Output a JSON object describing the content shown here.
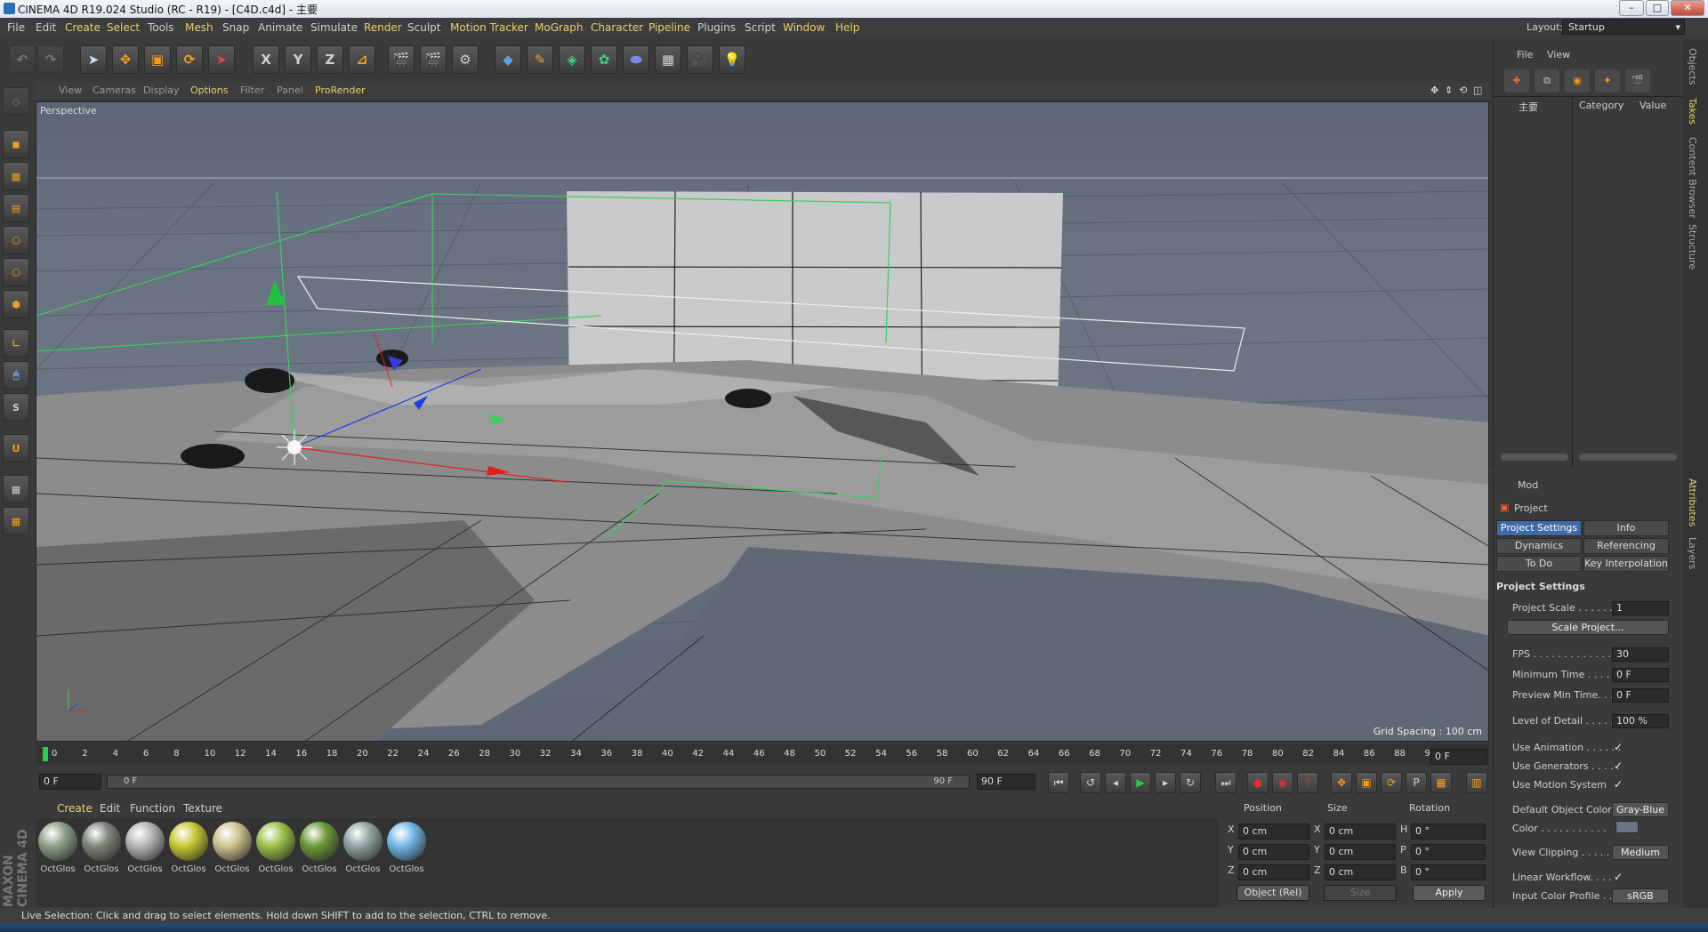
{
  "window": {
    "title": "CINEMA 4D R19.024 Studio (RC - R19) - [C4D.c4d] - 主要",
    "layout_label": "Layout:",
    "layout_value": "Startup"
  },
  "menu": [
    "File",
    "Edit",
    "Create",
    "Select",
    "Tools",
    "Mesh",
    "Snap",
    "Animate",
    "Simulate",
    "Render",
    "Sculpt",
    "Motion Tracker",
    "MoGraph",
    "Character",
    "Pipeline",
    "Plugins",
    "Script",
    "Window",
    "Help"
  ],
  "toolbar": {
    "axis_x": "X",
    "axis_y": "Y",
    "axis_z": "Z"
  },
  "viewport": {
    "menu": [
      "View",
      "Cameras",
      "Display",
      "Options",
      "Filter",
      "Panel",
      "ProRender"
    ],
    "label": "Perspective",
    "grid_spacing": "Grid Spacing : 100 cm"
  },
  "timeline": {
    "ticks": [
      "0",
      "2",
      "4",
      "6",
      "8",
      "10",
      "12",
      "14",
      "16",
      "18",
      "20",
      "22",
      "24",
      "26",
      "28",
      "30",
      "32",
      "34",
      "36",
      "38",
      "40",
      "42",
      "44",
      "46",
      "48",
      "50",
      "52",
      "54",
      "56",
      "58",
      "60",
      "62",
      "64",
      "66",
      "68",
      "70",
      "72",
      "74",
      "76",
      "78",
      "80",
      "82",
      "84",
      "86",
      "88",
      "90"
    ],
    "current_frame": "0 F",
    "start": "0 F",
    "range_start": "0 F",
    "range_end": "90 F",
    "end": "90 F"
  },
  "materials": {
    "menu": [
      "Create",
      "Edit",
      "Function",
      "Texture"
    ],
    "items": [
      {
        "label": "OctGlos",
        "color": "#8fa08a"
      },
      {
        "label": "OctGlos",
        "color": "#7e877a"
      },
      {
        "label": "OctGlos",
        "color": "#b5b5b5"
      },
      {
        "label": "OctGlos",
        "color": "#c7c936"
      },
      {
        "label": "OctGlos",
        "color": "#cdc48e"
      },
      {
        "label": "OctGlos",
        "color": "#9ac24a"
      },
      {
        "label": "OctGlos",
        "color": "#6e9a3a"
      },
      {
        "label": "OctGlos",
        "color": "#8fa4a0"
      },
      {
        "label": "OctGlos",
        "color": "#72b8e8"
      }
    ]
  },
  "coordinates": {
    "headers": [
      "Position",
      "Size",
      "Rotation"
    ],
    "rows": [
      {
        "axis": "X",
        "pos": "0 cm",
        "size_axis": "X",
        "size": "0 cm",
        "rot_axis": "H",
        "rot": "0 °"
      },
      {
        "axis": "Y",
        "pos": "0 cm",
        "size_axis": "Y",
        "size": "0 cm",
        "rot_axis": "P",
        "rot": "0 °"
      },
      {
        "axis": "Z",
        "pos": "0 cm",
        "size_axis": "Z",
        "size": "0 cm",
        "rot_axis": "B",
        "rot": "0 °"
      }
    ],
    "mode": "Object (Rel)",
    "size_mode": "Size",
    "apply": "Apply"
  },
  "status": "Live Selection: Click and drag to select elements. Hold down SHIFT to add to the selection, CTRL to remove.",
  "objects_panel": {
    "menu": [
      "File",
      "View"
    ],
    "tree_item": "主要",
    "col_category": "Category",
    "col_value": "Value"
  },
  "attributes_panel": {
    "mode": "Mod",
    "object": "Project",
    "tabs": [
      "Project Settings",
      "Info",
      "Dynamics",
      "Referencing",
      "To Do",
      "Key Interpolation"
    ],
    "section": "Project Settings",
    "rows": {
      "project_scale_label": "Project Scale . . . . . .",
      "project_scale": "1",
      "scale_project_btn": "Scale Project...",
      "fps_label": "FPS . . . . . . . . . . . . . .",
      "fps": "30",
      "min_time_label": "Minimum Time . . . . .",
      "min_time": "0 F",
      "preview_min_label": "Preview Min Time. . .",
      "preview_min": "0 F",
      "lod_label": "Level of Detail . . . . .",
      "lod": "100 %",
      "use_anim_label": "Use Animation . . . . . .",
      "use_gen_label": "Use Generators . . . . .",
      "use_motion_label": "Use Motion System",
      "def_color_label": "Default Object Color",
      "def_color": "Gray-Blue",
      "color_label": "Color . . . . . . . . . . .",
      "view_clip_label": "View Clipping . . . . . .",
      "view_clip": "Medium",
      "linear_wf_label": "Linear Workflow. . . .",
      "icp_label": "Input Color Profile . .",
      "icp": "sRGB"
    }
  },
  "side_tabs": [
    "Objects",
    "Takes",
    "Content Browser",
    "Structure",
    "Attributes",
    "Layers"
  ],
  "colors": {
    "accent": "#e8d26a",
    "active_tab": "#3f6aa8",
    "x_axis": "#e02020",
    "y_axis": "#20c020",
    "z_axis": "#2040e0"
  }
}
